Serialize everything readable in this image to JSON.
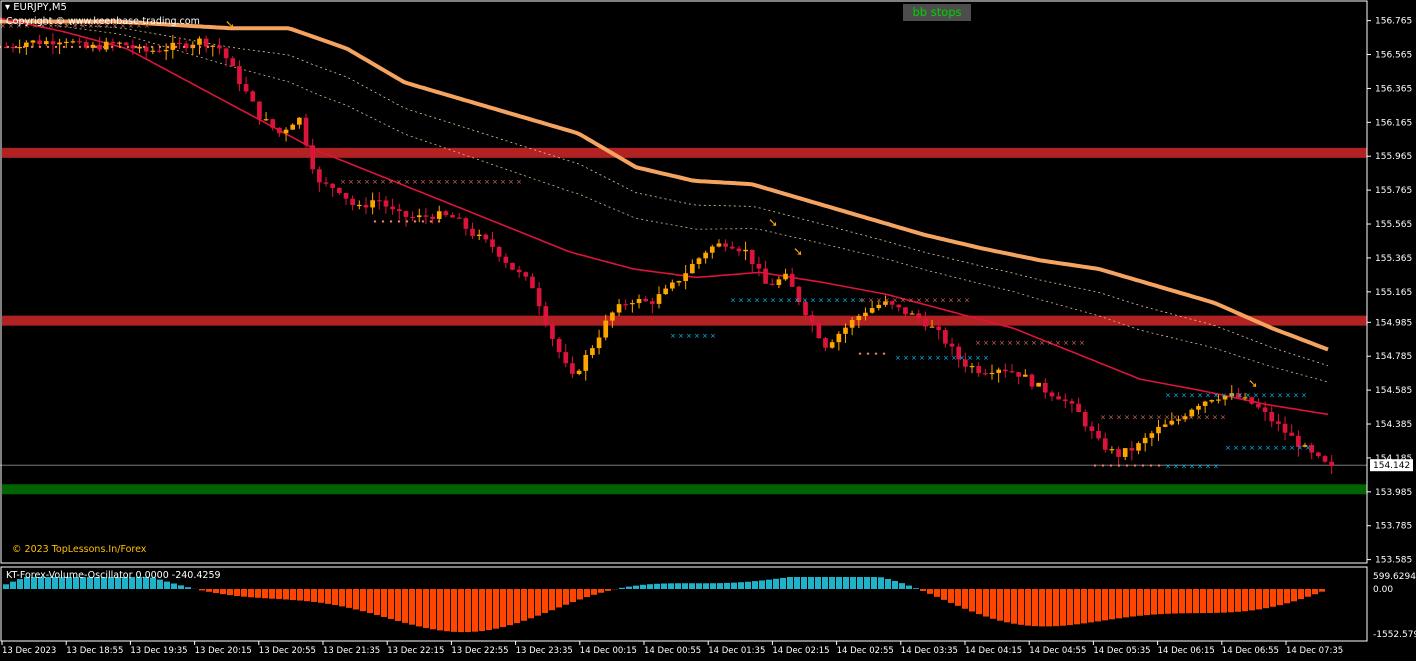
{
  "header": {
    "symbol": "EURJPY,M5",
    "copyright": "Copyright © www.keenbase-trading.com",
    "button_label": "bb stops",
    "watermark": "© 2023 TopLessons.In/Forex"
  },
  "oscillator": {
    "label": "KT-Forex-Volume-Oscillator 0.0000 -240.4259",
    "ticks": [
      "599.6294",
      "0.00",
      "-1552.5794"
    ]
  },
  "colors": {
    "bull_candle": "#ffa500",
    "bear_candle": "#dc143c",
    "ma_line": "#dc143c",
    "upper_band": "#f4a460",
    "support_zone": "#006400",
    "resistance_zone": "#b22222",
    "osc_positive": "#20b2c8",
    "osc_negative": "#ff4500",
    "stop_marker": "#00bfff"
  },
  "chart_data": {
    "type": "candlestick",
    "price_axis": {
      "range": [
        153.565,
        156.875
      ],
      "tick_labels": [
        "156.765",
        "156.565",
        "156.365",
        "156.165",
        "155.965",
        "155.765",
        "155.565",
        "155.365",
        "155.165",
        "154.985",
        "154.785",
        "154.585",
        "154.385",
        "154.185",
        "153.985",
        "153.785",
        "153.585"
      ],
      "current_price": "154.142"
    },
    "time_axis": [
      "13 Dec 2023",
      "13 Dec 18:55",
      "13 Dec 19:35",
      "13 Dec 20:15",
      "13 Dec 20:55",
      "13 Dec 21:35",
      "13 Dec 22:15",
      "13 Dec 22:55",
      "13 Dec 23:35",
      "14 Dec 00:15",
      "14 Dec 00:55",
      "14 Dec 01:35",
      "14 Dec 02:15",
      "14 Dec 02:55",
      "14 Dec 03:35",
      "14 Dec 04:15",
      "14 Dec 04:55",
      "14 Dec 05:35",
      "14 Dec 06:15",
      "14 Dec 06:55",
      "14 Dec 07:35"
    ],
    "zones": [
      {
        "type": "resistance",
        "price": 155.985
      },
      {
        "type": "resistance",
        "price": 154.995
      },
      {
        "type": "support",
        "price": 154.0
      }
    ],
    "close_path": [
      156.61,
      156.64,
      156.64,
      156.66,
      156.6,
      156.62,
      156.63,
      156.58,
      156.6,
      156.62,
      156.65,
      156.6,
      156.4,
      156.2,
      156.1,
      156.2,
      155.8,
      155.78,
      155.65,
      155.72,
      155.62,
      155.6,
      155.62,
      155.6,
      155.5,
      155.43,
      155.3,
      155.2,
      154.9,
      154.65,
      154.83,
      155.03,
      155.12,
      155.1,
      155.18,
      155.3,
      155.42,
      155.46,
      155.4,
      155.2,
      155.25,
      155.05,
      154.85,
      154.95,
      155.05,
      155.1,
      155.05,
      155.0,
      154.9,
      154.75,
      154.7,
      154.72,
      154.68,
      154.6,
      154.55,
      154.45,
      154.28,
      154.2,
      154.25,
      154.35,
      154.4,
      154.5,
      154.55,
      154.55,
      154.5,
      154.4,
      154.3,
      154.2,
      154.12
    ],
    "ma_path": [
      156.78,
      156.7,
      156.6,
      156.4,
      156.2,
      156.0,
      155.85,
      155.7,
      155.55,
      155.4,
      155.3,
      155.25,
      155.28,
      155.22,
      155.15,
      155.05,
      154.95,
      154.8,
      154.65,
      154.58,
      154.5,
      154.44
    ],
    "upper_band_path": [
      156.76,
      156.76,
      156.76,
      156.74,
      156.72,
      156.72,
      156.6,
      156.4,
      156.3,
      156.2,
      156.1,
      155.9,
      155.82,
      155.8,
      155.7,
      155.6,
      155.5,
      155.42,
      155.35,
      155.3,
      155.2,
      155.1,
      154.95,
      154.82
    ]
  }
}
